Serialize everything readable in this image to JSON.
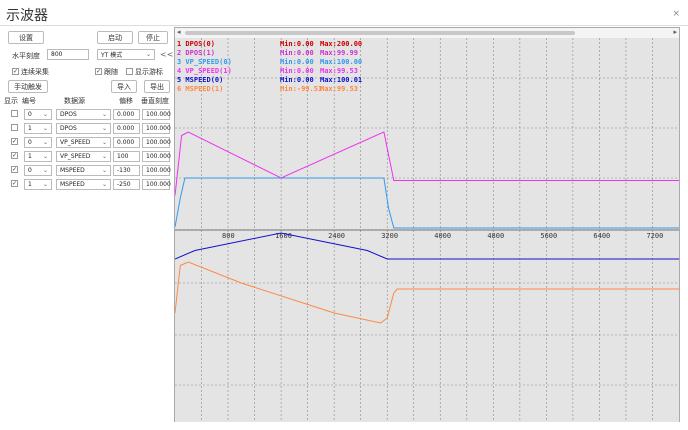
{
  "window": {
    "title": "示波器"
  },
  "toolbar": {
    "settings_label": "设置",
    "start_label": "启动",
    "stop_label": "停止",
    "h_scale_label": "水平刻度",
    "h_scale_value": "800",
    "mode_value": "YT 模式",
    "collapse_label": "<<",
    "continuous_label": "连续采集",
    "trigger_label": "跟随",
    "crosshair_label": "显示游标",
    "manual_trigger_label": "手动触发",
    "import_label": "导入",
    "export_label": "导出"
  },
  "table": {
    "headers": [
      "显示",
      "编号",
      "数据源",
      "偏移",
      "垂直刻度"
    ],
    "rows": [
      {
        "checked": false,
        "num": "0",
        "source": "DPOS",
        "offset": "0.000",
        "scale": "100.000"
      },
      {
        "checked": false,
        "num": "1",
        "source": "DPOS",
        "offset": "0.000",
        "scale": "100.000"
      },
      {
        "checked": true,
        "num": "0",
        "source": "VP_SPEED",
        "offset": "0.000",
        "scale": "100.000"
      },
      {
        "checked": true,
        "num": "1",
        "source": "VP_SPEED",
        "offset": "100",
        "scale": "100.000"
      },
      {
        "checked": true,
        "num": "0",
        "source": "MSPEED",
        "offset": "-130",
        "scale": "100.000"
      },
      {
        "checked": true,
        "num": "1",
        "source": "MSPEED",
        "offset": "-250",
        "scale": "100.000"
      }
    ]
  },
  "icons": {
    "close": "close-icon",
    "scroll_left": "scroll-left-icon",
    "scroll_right": "scroll-right-icon",
    "dropdown": "chevron-down-icon"
  },
  "chart_data": {
    "type": "line",
    "x_ticks": [
      "800",
      "1600",
      "2400",
      "3200",
      "4000",
      "4800",
      "5600",
      "6400",
      "7200"
    ],
    "xlim": [
      0,
      7600
    ],
    "legend": [
      {
        "label": "1 DPOS(0)",
        "min": "Min:0.00",
        "max": "Max:200.00",
        "color": "#cc0000"
      },
      {
        "label": "2 DPOS(1)",
        "min": "Min:0.00",
        "max": "Max:99.99",
        "color": "#cc33cc"
      },
      {
        "label": "3 VP_SPEED(0)",
        "min": "Min:0.00",
        "max": "Max:100.00",
        "color": "#3399ee"
      },
      {
        "label": "4 VP_SPEED(1)",
        "min": "Min:0.00",
        "max": "Max:99.53",
        "color": "#ee33ee"
      },
      {
        "label": "5 MSPEED(0)",
        "min": "Min:0.00",
        "max": "Max:100.01",
        "color": "#1111cc"
      },
      {
        "label": "6 MSPEED(1)",
        "min": "Min:-99.51",
        "max": "Max:99.53",
        "color": "#ff8844"
      }
    ],
    "series": [
      {
        "color": "#ee33ee",
        "points": [
          [
            0,
            -35
          ],
          [
            100,
            85
          ],
          [
            200,
            92
          ],
          [
            1600,
            0
          ],
          [
            3150,
            92
          ],
          [
            3300,
            -5
          ],
          [
            7600,
            -5
          ]
        ]
      },
      {
        "color": "#3399ee",
        "points": [
          [
            0,
            -98
          ],
          [
            80,
            -40
          ],
          [
            150,
            0
          ],
          [
            3150,
            0
          ],
          [
            3220,
            -60
          ],
          [
            3300,
            -100
          ],
          [
            7600,
            -100
          ]
        ]
      },
      {
        "color": "#1111cc",
        "points": [
          [
            0,
            -162
          ],
          [
            300,
            -145
          ],
          [
            1600,
            -110
          ],
          [
            2900,
            -145
          ],
          [
            3200,
            -162
          ],
          [
            7600,
            -162
          ]
        ]
      },
      {
        "color": "#ff8844",
        "points": [
          [
            0,
            -270
          ],
          [
            80,
            -175
          ],
          [
            200,
            -168
          ],
          [
            1000,
            -210
          ],
          [
            2400,
            -270
          ],
          [
            3100,
            -290
          ],
          [
            3200,
            -280
          ],
          [
            3300,
            -230
          ],
          [
            3350,
            -222
          ],
          [
            7600,
            -222
          ]
        ]
      }
    ]
  }
}
